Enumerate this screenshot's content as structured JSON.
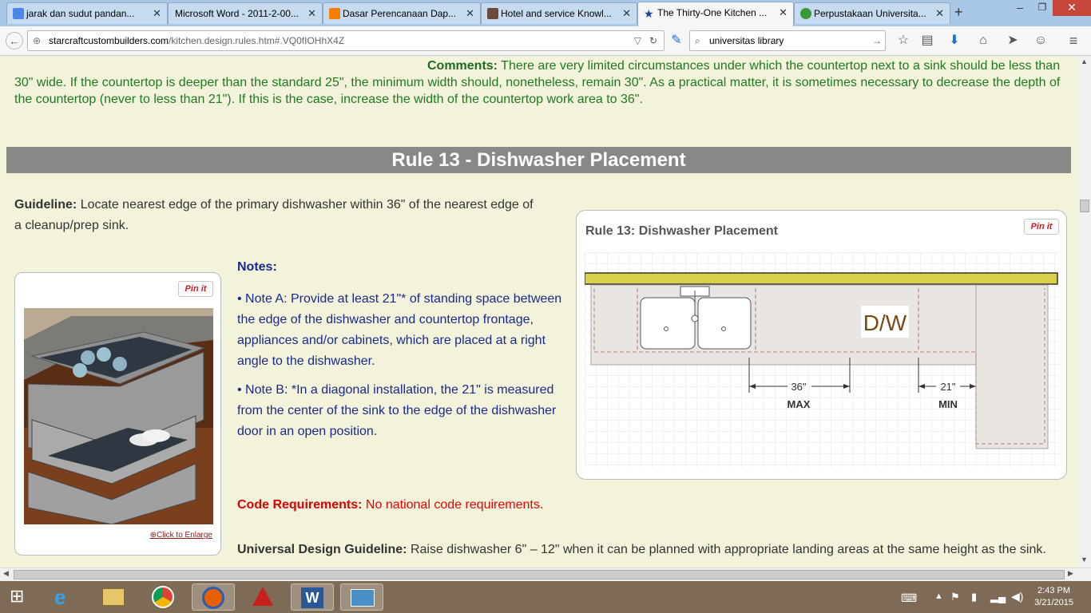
{
  "browser": {
    "tabs": [
      {
        "label": "jarak dan sudut pandan...",
        "icon": "google-icon"
      },
      {
        "label": "Microsoft Word - 2011-2-00...",
        "icon": "blank-page-icon"
      },
      {
        "label": "Dasar Perencanaan Dap...",
        "icon": "blogger-icon"
      },
      {
        "label": "Hotel and service Knowl...",
        "icon": "profile-icon"
      },
      {
        "label": "The Thirty-One Kitchen ...",
        "icon": "star-icon",
        "active": true
      },
      {
        "label": "Perpustakaan Universita...",
        "icon": "library-icon"
      }
    ],
    "url_host": "starcraftcustombuilders.com",
    "url_path": "/kitchen.design.rules.htm#.VQ0fIOHhX4Z",
    "search_value": "universitas library"
  },
  "page": {
    "comments_label": "Comments:",
    "comments_text": "There are very limited circumstances under which the countertop next to a sink should be less than 30\" wide. If the countertop is deeper than the standard 25\", the minimum width should, nonetheless, remain 30\". As a practical matter, it is sometimes necessary to decrease the depth of the countertop (never to less than 21\"). If this is the case, increase the width of the countertop work area to 36\".",
    "rule_heading": "Rule 13 - Dishwasher Placement",
    "guideline_label": "Guideline:",
    "guideline_text": "Locate nearest edge of the primary dishwasher within 36\" of the nearest edge of a cleanup/prep sink.",
    "pin_label": "Pin it",
    "enlarge_label": "Click to Enlarge",
    "notes_label": "Notes:",
    "note_a": "Note A: Provide at least 21\"* of standing space between the edge of the dishwasher and countertop frontage, appliances and/or cabinets, which are placed at a right angle to the dishwasher.",
    "note_b": "Note B: *In a diagonal installation, the 21\" is measured from the center of the sink to the edge of the dishwasher door in an open position.",
    "code_label": "Code Requirements:",
    "code_text": "No national code requirements.",
    "udg_label": "Universal Design Guideline:",
    "udg_text": "Raise dishwasher 6\" – 12\" when it can be planned with appropriate landing areas at the same height as the sink.",
    "diagram": {
      "title": "Rule 13: Dishwasher Placement",
      "dw_label": "D/W",
      "dim_max_value": "36\"",
      "dim_max_label": "MAX",
      "dim_min_value": "21\"",
      "dim_min_label": "MIN"
    }
  },
  "taskbar": {
    "time": "2:43 PM",
    "date": "3/21/2015"
  }
}
